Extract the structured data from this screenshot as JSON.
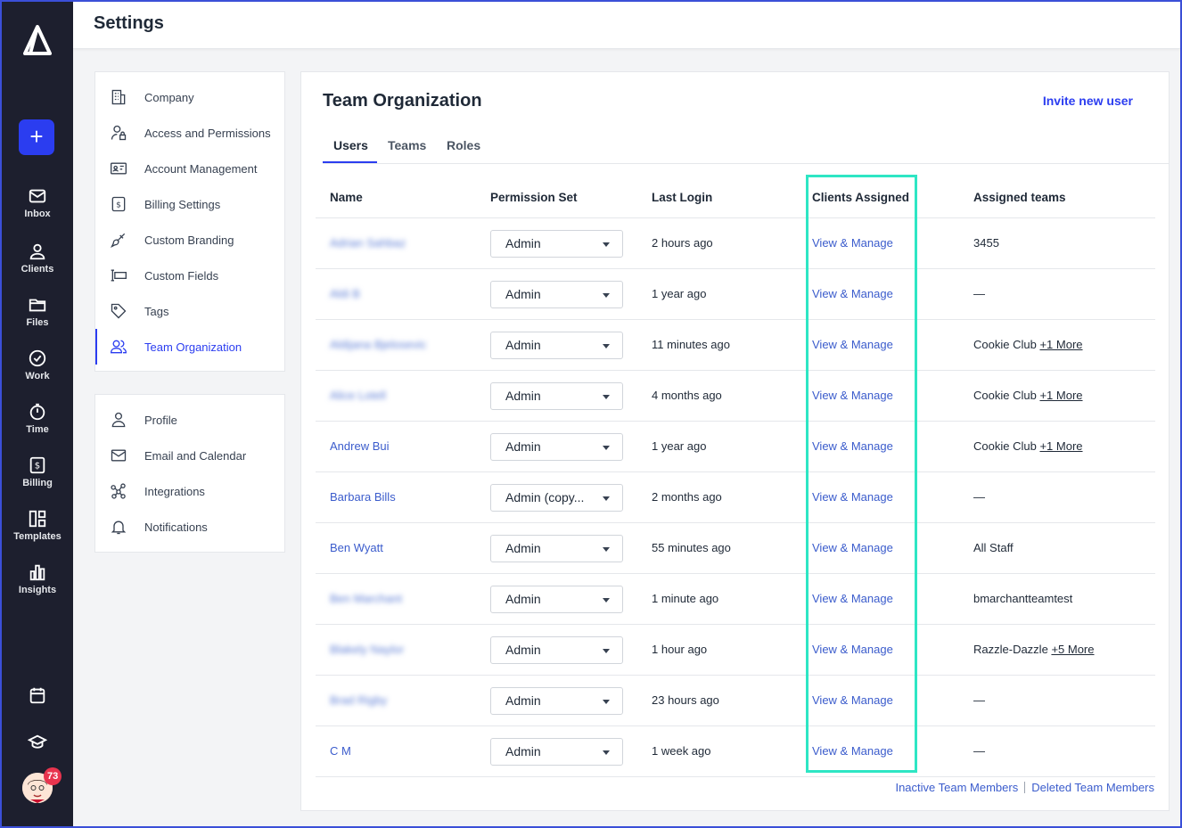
{
  "nav": {
    "items": [
      {
        "label": "Inbox",
        "icon": "mail-icon"
      },
      {
        "label": "Clients",
        "icon": "users-icon"
      },
      {
        "label": "Files",
        "icon": "folder-icon"
      },
      {
        "label": "Work",
        "icon": "check-circle-icon"
      },
      {
        "label": "Time",
        "icon": "timer-icon"
      },
      {
        "label": "Billing",
        "icon": "dollar-icon"
      },
      {
        "label": "Templates",
        "icon": "templates-icon"
      },
      {
        "label": "Insights",
        "icon": "bar-chart-icon"
      }
    ],
    "plus": "+",
    "notification_count": "73"
  },
  "topbar": {
    "title": "Settings"
  },
  "settings_menu": {
    "group1": [
      {
        "label": "Company"
      },
      {
        "label": "Access and Permissions"
      },
      {
        "label": "Account Management"
      },
      {
        "label": "Billing Settings"
      },
      {
        "label": "Custom Branding"
      },
      {
        "label": "Custom Fields"
      },
      {
        "label": "Tags"
      },
      {
        "label": "Team Organization"
      }
    ],
    "group2": [
      {
        "label": "Profile"
      },
      {
        "label": "Email and Calendar"
      },
      {
        "label": "Integrations"
      },
      {
        "label": "Notifications"
      }
    ]
  },
  "main": {
    "title": "Team Organization",
    "invite_label": "Invite new user",
    "tabs": [
      {
        "label": "Users"
      },
      {
        "label": "Teams"
      },
      {
        "label": "Roles"
      }
    ],
    "columns": {
      "name": "Name",
      "permission": "Permission Set",
      "last_login": "Last Login",
      "clients": "Clients Assigned",
      "teams": "Assigned teams"
    },
    "rows": [
      {
        "name": "Adrian Sahbaz",
        "permission": "Admin",
        "last_login": "2 hours ago",
        "clients": "View & Manage",
        "teams": "3455",
        "more": ""
      },
      {
        "name": "Aldi B",
        "permission": "Admin",
        "last_login": "1 year ago",
        "clients": "View & Manage",
        "teams": "—",
        "more": ""
      },
      {
        "name": "Aldijana Bjelosevic",
        "permission": "Admin",
        "last_login": "11 minutes ago",
        "clients": "View & Manage",
        "teams": "Cookie Club",
        "more": "+1 More"
      },
      {
        "name": "Alice Lotell",
        "permission": "Admin",
        "last_login": "4 months ago",
        "clients": "View & Manage",
        "teams": "Cookie Club",
        "more": "+1 More"
      },
      {
        "name": "Andrew Bui",
        "permission": "Admin",
        "last_login": "1 year ago",
        "clients": "View & Manage",
        "teams": "Cookie Club",
        "more": "+1 More"
      },
      {
        "name": "Barbara Bills",
        "permission": "Admin (copy...",
        "last_login": "2 months ago",
        "clients": "View & Manage",
        "teams": "—",
        "more": ""
      },
      {
        "name": "Ben Wyatt",
        "permission": "Admin",
        "last_login": "55 minutes ago",
        "clients": "View & Manage",
        "teams": "All Staff",
        "more": ""
      },
      {
        "name": "Ben Marchant",
        "permission": "Admin",
        "last_login": "1 minute ago",
        "clients": "View & Manage",
        "teams": "bmarchantteamtest",
        "more": ""
      },
      {
        "name": "Blakely Naylor",
        "permission": "Admin",
        "last_login": "1 hour ago",
        "clients": "View & Manage",
        "teams": "Razzle-Dazzle",
        "more": "+5 More"
      },
      {
        "name": "Brad Rigby",
        "permission": "Admin",
        "last_login": "23 hours ago",
        "clients": "View & Manage",
        "teams": "—",
        "more": ""
      },
      {
        "name": "C M",
        "permission": "Admin",
        "last_login": "1 week ago",
        "clients": "View & Manage",
        "teams": "—",
        "more": ""
      }
    ],
    "footer": {
      "inactive": "Inactive Team Members",
      "deleted": "Deleted Team Members"
    }
  },
  "colors": {
    "accent": "#2b3df0",
    "link": "#3b5ccc",
    "nav_bg": "#1d1f2e",
    "highlight": "#2ee6c4",
    "badge": "#e8344e"
  }
}
